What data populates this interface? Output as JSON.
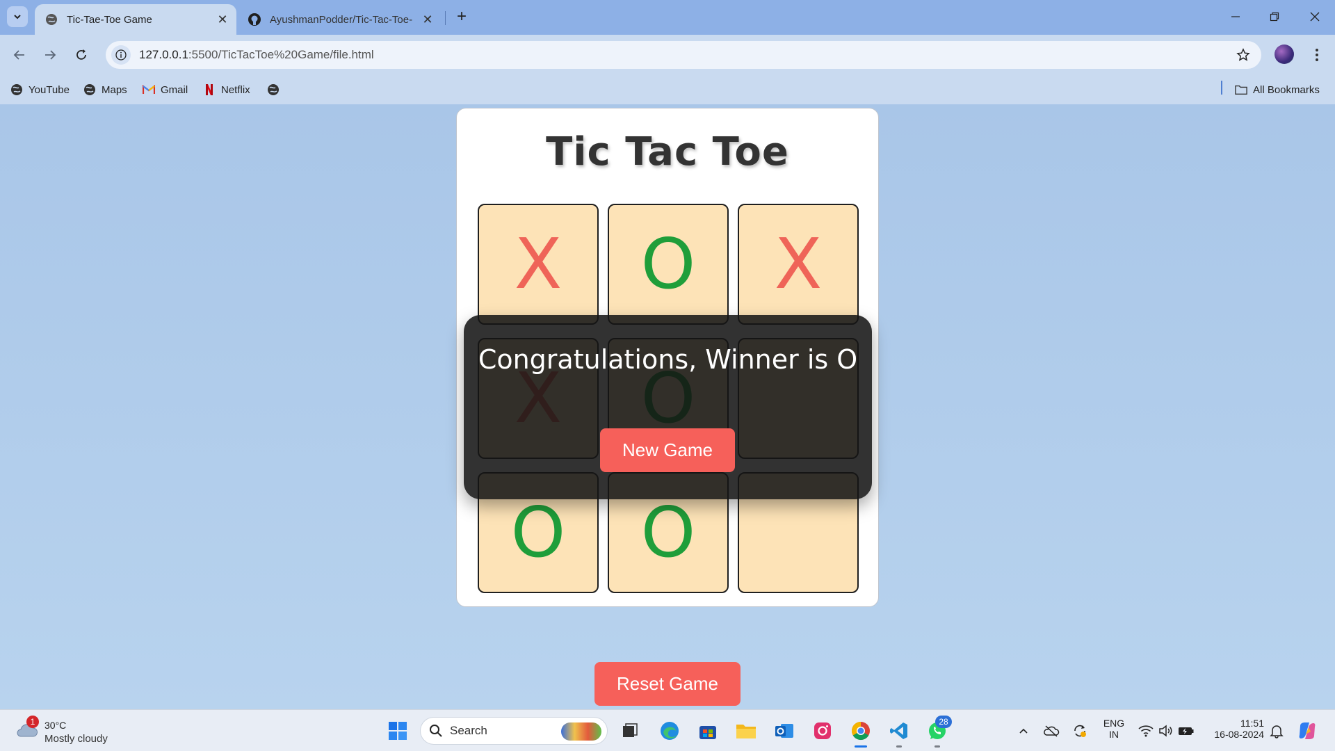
{
  "browser": {
    "tabs": [
      {
        "title": "Tic-Tae-Toe Game",
        "active": true
      },
      {
        "title": "AyushmanPodder/Tic-Tac-Toe-",
        "active": false
      }
    ],
    "url_host": "127.0.0.1",
    "url_rest": ":5500/TicTacToe%20Game/file.html",
    "bookmarks": [
      "YouTube",
      "Maps",
      "Gmail",
      "Netflix"
    ],
    "all_bookmarks_label": "All Bookmarks"
  },
  "game": {
    "title": "Tic Tac Toe",
    "board": [
      "X",
      "O",
      "X",
      "X",
      "O",
      "",
      "O",
      "O",
      ""
    ],
    "winner_message": "Congratulations, Winner is O",
    "new_game_label": "New Game",
    "reset_label": "Reset Game",
    "colors": {
      "x": "#ef6458",
      "o": "#1f9e3a",
      "cell_bg": "#fde3b7",
      "button": "#f6605a"
    }
  },
  "taskbar": {
    "weather_badge": "1",
    "temperature": "30°C",
    "condition": "Mostly cloudy",
    "search_label": "Search",
    "whatsapp_badge": "28",
    "lang_top": "ENG",
    "lang_bottom": "IN",
    "time": "11:51",
    "date": "16-08-2024"
  }
}
